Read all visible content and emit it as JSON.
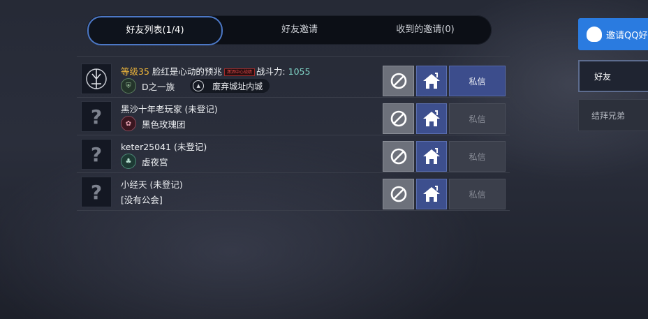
{
  "tabs": [
    {
      "label": "好友列表(1/4)"
    },
    {
      "label": "好友邀请"
    },
    {
      "label": "收到的邀请(0)"
    }
  ],
  "friends": [
    {
      "avatar": "",
      "level": "等级35",
      "name": "脸红是心动的预兆",
      "title_badge": "潇洒中心战绩",
      "power_label": "战斗力:",
      "power": "1055",
      "guild": "D之一族",
      "location": "废弃城址内城",
      "message": "私信"
    },
    {
      "avatar": "?",
      "name": "黑沙十年老玩家 (未登记)",
      "guild": "黑色玫瑰团",
      "message": "私信"
    },
    {
      "avatar": "?",
      "name": "keter25041 (未登记)",
      "guild": "虚夜宫",
      "message": "私信"
    },
    {
      "avatar": "?",
      "name": "小经天 (未登记)",
      "guild": "[没有公会]",
      "message": "私信"
    }
  ],
  "side": {
    "invite_qq": "邀请QQ好",
    "friend": "好友",
    "sworn": "结拜兄弟"
  },
  "colors": {
    "tab_active_border": "#4c78c6",
    "level": "#f0b73a",
    "power": "#7fd3c6",
    "qq_button": "#2a7be0",
    "home_button": "#3d4f8e"
  }
}
